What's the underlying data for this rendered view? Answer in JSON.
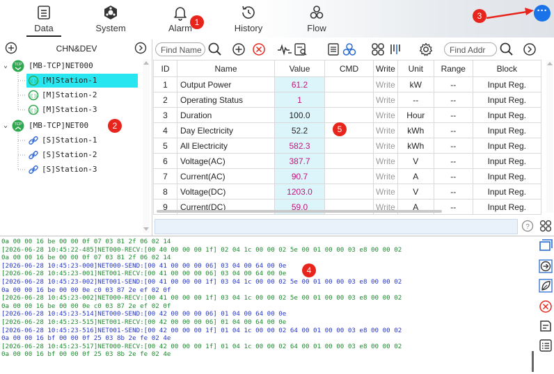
{
  "nav": {
    "items": [
      {
        "label": "Data",
        "icon": "data-icon"
      },
      {
        "label": "System",
        "icon": "system-icon"
      },
      {
        "label": "Alarm",
        "icon": "bell-icon"
      },
      {
        "label": "History",
        "icon": "history-icon"
      },
      {
        "label": "Flow",
        "icon": "flow-icon"
      }
    ],
    "active": "Data"
  },
  "badges": {
    "b1": "1",
    "b2": "2",
    "b3": "3",
    "b4": "4",
    "b5": "5"
  },
  "more_label": "···",
  "left_panel": {
    "title": "CHN&DEV",
    "tree": [
      {
        "label": "[MB-TCP]NET000",
        "type": "master-root"
      },
      {
        "label": "[M]Station-1",
        "type": "master-station",
        "selected": true
      },
      {
        "label": "[M]Station-2",
        "type": "master-station"
      },
      {
        "label": "[M]Station-3",
        "type": "master-station"
      },
      {
        "label": "[MB-TCP]NET00",
        "type": "slave-root"
      },
      {
        "label": "[S]Station-1",
        "type": "slave-station"
      },
      {
        "label": "[S]Station-2",
        "type": "slave-station"
      },
      {
        "label": "[S]Station-3",
        "type": "slave-station"
      }
    ]
  },
  "toolbar": {
    "find_name_placeholder": "Find Name",
    "find_addr_placeholder": "Find Addr"
  },
  "table": {
    "columns": [
      "ID",
      "Name",
      "Value",
      "CMD",
      "Write",
      "Unit",
      "Range",
      "Block"
    ],
    "rows": [
      {
        "id": "1",
        "name": "Output Power",
        "value": "61.2",
        "cmd": "",
        "write": "Write",
        "unit": "kW",
        "range": "--",
        "block": "Input Reg."
      },
      {
        "id": "2",
        "name": "Operating Status",
        "value": "1",
        "cmd": "",
        "write": "Write",
        "unit": "--",
        "range": "--",
        "block": "Input Reg."
      },
      {
        "id": "3",
        "name": "Duration",
        "value": "100.0",
        "cmd": "",
        "write": "Write",
        "unit": "Hour",
        "range": "--",
        "block": "Input Reg."
      },
      {
        "id": "4",
        "name": "Day Electricity",
        "value": "52.2",
        "cmd": "",
        "write": "Write",
        "unit": "kWh",
        "range": "--",
        "block": "Input Reg."
      },
      {
        "id": "5",
        "name": "All Electricity",
        "value": "582.3",
        "cmd": "",
        "write": "Write",
        "unit": "kWh",
        "range": "--",
        "block": "Input Reg."
      },
      {
        "id": "6",
        "name": "Voltage(AC)",
        "value": "387.7",
        "cmd": "",
        "write": "Write",
        "unit": "V",
        "range": "--",
        "block": "Input Reg."
      },
      {
        "id": "7",
        "name": "Current(AC)",
        "value": "90.7",
        "cmd": "",
        "write": "Write",
        "unit": "A",
        "range": "--",
        "block": "Input Reg."
      },
      {
        "id": "8",
        "name": "Voltage(DC)",
        "value": "1203.0",
        "cmd": "",
        "write": "Write",
        "unit": "V",
        "range": "--",
        "block": "Input Reg."
      },
      {
        "id": "9",
        "name": "Current(DC)",
        "value": "59.0",
        "cmd": "",
        "write": "Write",
        "unit": "A",
        "range": "--",
        "block": "Input Reg."
      }
    ]
  },
  "log": [
    {
      "kind": "recv",
      "text": "0a 00 00 16 be 00 00 0f 07 03 81 2f 06 02 14"
    },
    {
      "kind": "recv",
      "text": "[2026-06-28 10:45:22-485]NET000-RECV:[00 40 00 00 00 1f] 02 04 1c 00 00 02 5e 00 01 00 00 03 e8 00 00 02"
    },
    {
      "kind": "recv",
      "text": "0a 00 00 16 be 00 00 0f 07 03 81 2f 06 02 14"
    },
    {
      "kind": "send",
      "text": "[2026-06-28 10:45:23-000]NET000-SEND:[00 41 00 00 00 06] 03 04 00 64 00 0e"
    },
    {
      "kind": "recv",
      "text": "[2026-06-28 10:45:23-001]NET001-RECV:[00 41 00 00 00 06] 03 04 00 64 00 0e"
    },
    {
      "kind": "send",
      "text": "[2026-06-28 10:45:23-002]NET001-SEND:[00 41 00 00 00 1f] 03 04 1c 00 00 02 5e 00 01 00 00 03 e8 00 00 02"
    },
    {
      "kind": "send",
      "text": "0a 00 00 16 be 00 00 0e c0 03 87 2e ef 02 0f"
    },
    {
      "kind": "recv",
      "text": "[2026-06-28 10:45:23-002]NET000-RECV:[00 41 00 00 00 1f] 03 04 1c 00 00 02 5e 00 01 00 00 03 e8 00 00 02"
    },
    {
      "kind": "recv",
      "text": "0a 00 00 16 be 00 00 0e c0 03 87 2e ef 02 0f"
    },
    {
      "kind": "send",
      "text": "[2026-06-28 10:45:23-514]NET000-SEND:[00 42 00 00 00 06] 01 04 00 64 00 0e"
    },
    {
      "kind": "recv",
      "text": "[2026-06-28 10:45:23-515]NET001-RECV:[00 42 00 00 00 06] 01 04 00 64 00 0e"
    },
    {
      "kind": "send",
      "text": "[2026-06-28 10:45:23-516]NET001-SEND:[00 42 00 00 00 1f] 01 04 1c 00 00 02 64 00 01 00 00 03 e8 00 00 02"
    },
    {
      "kind": "send",
      "text": "0a 00 00 16 bf 00 00 0f 25 03 8b 2e fe 02 4e"
    },
    {
      "kind": "recv",
      "text": "[2026-06-28 10:45:23-517]NET000-RECV:[00 42 00 00 00 1f] 01 04 1c 00 00 02 64 00 01 00 00 03 e8 00 00 02"
    },
    {
      "kind": "recv",
      "text": "0a 00 00 16 bf 00 00 0f 25 03 8b 2e fe 02 4e"
    }
  ],
  "colors": {
    "accent": "#1a73e8",
    "badge": "#e8251c",
    "selected_row": "#27e6f0",
    "value_bg": "#dcf5fb",
    "value_text": "#c01478",
    "recv": "#1c8a2e",
    "send": "#2536c9"
  }
}
